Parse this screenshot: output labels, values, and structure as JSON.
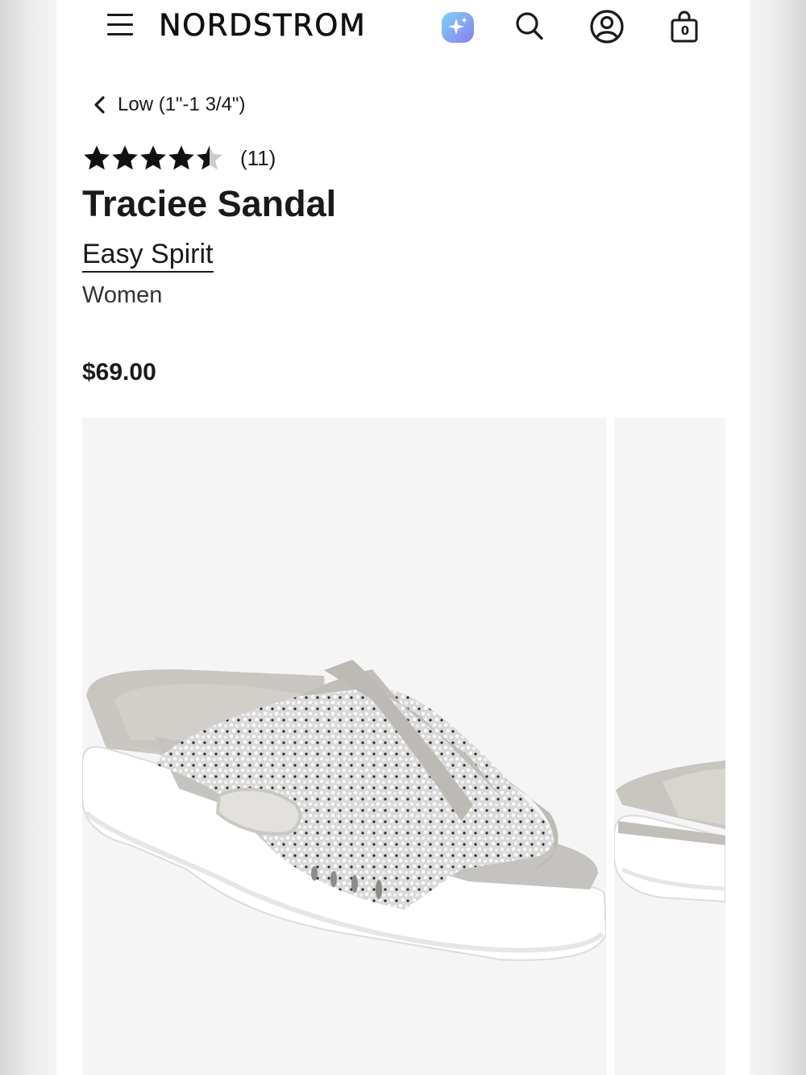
{
  "header": {
    "logo": "NORDSTROM",
    "menu_icon": "hamburger-menu-icon",
    "ai_icon": "sparkle-assistant-icon",
    "search_icon": "search-icon",
    "account_icon": "account-icon",
    "bag_icon": "shopping-bag-icon",
    "bag_count": "0"
  },
  "breadcrumb": {
    "label": "Low (1\"-1 3/4\")"
  },
  "product": {
    "rating": 4.5,
    "rating_max": 5,
    "review_count": "(11)",
    "title": "Traciee Sandal",
    "brand": "Easy Spirit",
    "category": "Women",
    "price": "$69.00"
  },
  "gallery": {
    "images": [
      {
        "subject": "Traciee Sandal - grey knit slide sandal, side view"
      },
      {
        "subject": "Traciee Sandal - alternate view"
      }
    ]
  },
  "colors": {
    "text": "#1a1a1a",
    "image_background": "#f5f5f5",
    "ai_icon_gradient": [
      "#7fd3f4",
      "#8a7cf0"
    ]
  }
}
